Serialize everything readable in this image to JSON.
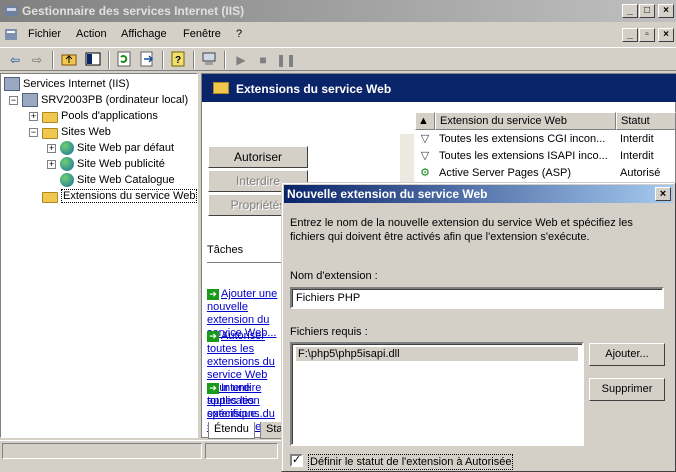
{
  "window": {
    "title": "Gestionnaire des services Internet (IIS)"
  },
  "menu": {
    "items": [
      "Fichier",
      "Action",
      "Affichage",
      "Fenêtre",
      "?"
    ]
  },
  "tree": {
    "root": "Services Internet (IIS)",
    "server": "SRV2003PB (ordinateur local)",
    "pools": "Pools d'applications",
    "sites": "Sites Web",
    "site1": "Site Web par défaut",
    "site2": "Site Web publicité",
    "site3": "Site Web Catalogue",
    "extensions": "Extensions du service Web"
  },
  "right": {
    "header": "Extensions du service Web",
    "buttons": {
      "allow": "Autoriser",
      "deny": "Interdire",
      "props": "Propriétés"
    },
    "tasks_heading": "Tâches",
    "tasks": [
      "Ajouter une nouvelle extension du service Web...",
      "Autoriser toutes les extensions du service Web pour une application spécifique...",
      "Interdire toutes les extensions du service Web"
    ],
    "columns": {
      "extension": "Extension du service Web",
      "status": "Statut"
    },
    "rows": [
      {
        "name": "Toutes les extensions CGI incon...",
        "status": "Interdit"
      },
      {
        "name": "Toutes les extensions ISAPI inco...",
        "status": "Interdit"
      },
      {
        "name": "Active Server Pages (ASP)",
        "status": "Autorisé"
      }
    ],
    "tabs": {
      "extended": "Étendu",
      "standard": "Standard"
    }
  },
  "dialog": {
    "title": "Nouvelle extension du service Web",
    "description": "Entrez le nom de la nouvelle extension du service Web et spécifiez les fichiers qui doivent être activés afin que l'extension s'exécute.",
    "name_label": "Nom d'extension :",
    "name_value": "Fichiers PHP",
    "files_label": "Fichiers requis :",
    "files": [
      "F:\\php5\\php5isapi.dll"
    ],
    "add_button": "Ajouter...",
    "remove_button": "Supprimer",
    "checkbox_label": "Définir le statut de l'extension à Autorisée",
    "checkbox_checked": true
  }
}
